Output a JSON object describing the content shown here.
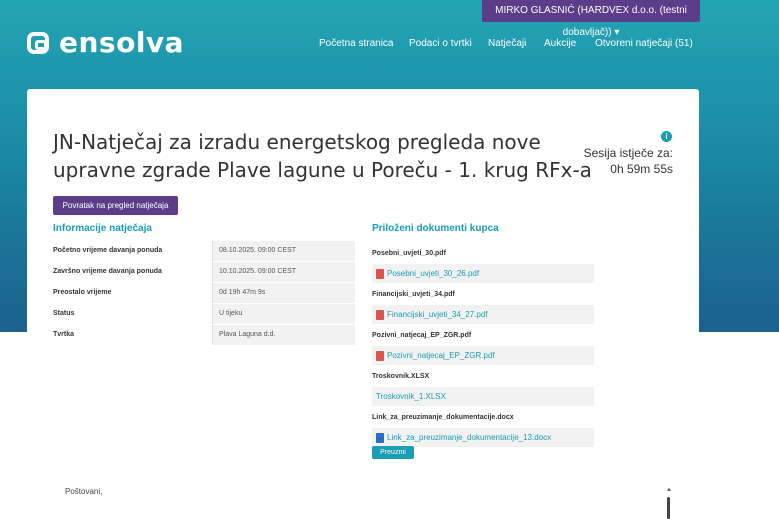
{
  "header": {
    "user_menu": "MIRKO GLASNIĆ (HARDVEX d.o.o. (testni dobavljač)) ▾",
    "logo_text": "ensolva",
    "nav": [
      "Početna stranica",
      "Podaci o tvrtki",
      "Natječaji",
      "Aukcije",
      "Otvoreni natječaji (51)"
    ]
  },
  "page": {
    "title": "JN-Natječaj za izradu energetskog pregleda nove upravne zgrade Plave lagune u Poreču - 1. krug RFx-a",
    "session_label": "Sesija istječe za:",
    "session_time": "0h 59m 55s",
    "info_icon": "i",
    "back_button": "Povratak na pregled natječaja"
  },
  "info": {
    "title": "Informacije natječaja",
    "rows": [
      {
        "label": "Početno vrijeme davanja ponuda",
        "value": "08.10.2025. 09:00 CEST"
      },
      {
        "label": "Završno vrijeme davanja ponuda",
        "value": "10.10.2025. 09:00 CEST"
      },
      {
        "label": "Preostalo vrijeme",
        "value": "0d 19h 47m 9s"
      },
      {
        "label": "Status",
        "value": "U tijeku"
      },
      {
        "label": "Tvrtka",
        "value": "Plava Laguna d.d."
      }
    ]
  },
  "docs": {
    "title": "Priloženi dokumenti kupca",
    "items": [
      {
        "name": "Posebni_uvjeti_30.pdf",
        "file": "Posebni_uvjeti_30_26.pdf",
        "icon": "pdf-icon"
      },
      {
        "name": "Financijski_uvjeti_34.pdf",
        "file": "Financijski_uvjeti_34_27.pdf",
        "icon": "pdf-icon"
      },
      {
        "name": "Pozivni_natjecaj_EP_ZGR.pdf",
        "file": "Pozivni_natjecaj_EP_ZGR.pdf",
        "icon": "pdf-icon"
      },
      {
        "name": "Troskovnik.XLSX",
        "file": "Troskovnik_1.XLSX",
        "icon": ""
      },
      {
        "name": "Link_za_preuzimanje_dokumentacije.docx",
        "file": "Link_za_preuzimanje_dokumentacije_13.docx",
        "icon": "word-icon"
      }
    ],
    "download_button": "Preuzmi"
  },
  "message": {
    "greeting": "Poštovani,"
  }
}
